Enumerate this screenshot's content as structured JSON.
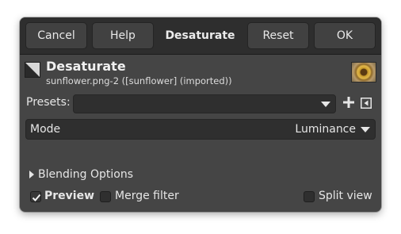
{
  "header": {
    "cancel": "Cancel",
    "help": "Help",
    "title": "Desaturate",
    "reset": "Reset",
    "ok": "OK"
  },
  "filter": {
    "name": "Desaturate",
    "subtitle": "sunflower.png-2 ([sunflower] (imported))",
    "icon": "desaturate-icon"
  },
  "presets": {
    "label": "Presets:",
    "value": "",
    "add_icon": "plus-icon",
    "menu_icon": "menu-icon"
  },
  "mode": {
    "label": "Mode",
    "value": "Luminance"
  },
  "blending": {
    "label": "Blending Options",
    "expanded": false
  },
  "options": {
    "preview": {
      "label": "Preview",
      "checked": true
    },
    "merge_filter": {
      "label": "Merge filter",
      "checked": false
    },
    "split_view": {
      "label": "Split view",
      "checked": false
    }
  },
  "colors": {
    "dialog_bg": "#454545",
    "header_bg": "#2e2e2e",
    "field_bg": "#2f2f2f",
    "text": "#e6e6e6"
  }
}
